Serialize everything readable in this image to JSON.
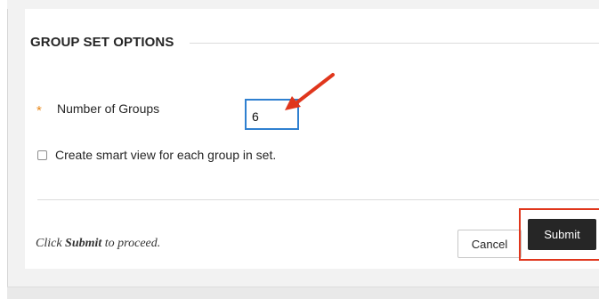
{
  "section": {
    "title": "GROUP SET OPTIONS"
  },
  "number_of_groups": {
    "required_marker": "*",
    "label": "Number of Groups",
    "value": "6"
  },
  "smart_view": {
    "label": "Create smart view for each group in set.",
    "checked": false
  },
  "footer": {
    "hint_prefix": "Click",
    "hint_bold": "Submit",
    "hint_suffix": "to proceed.",
    "cancel_label": "Cancel",
    "submit_label": "Submit"
  },
  "annotations": {
    "arrow_icon": "red-arrow-icon",
    "highlight_color": "#e0361c",
    "input_focus_color": "#2f80d0",
    "required_color": "#e8891c"
  }
}
